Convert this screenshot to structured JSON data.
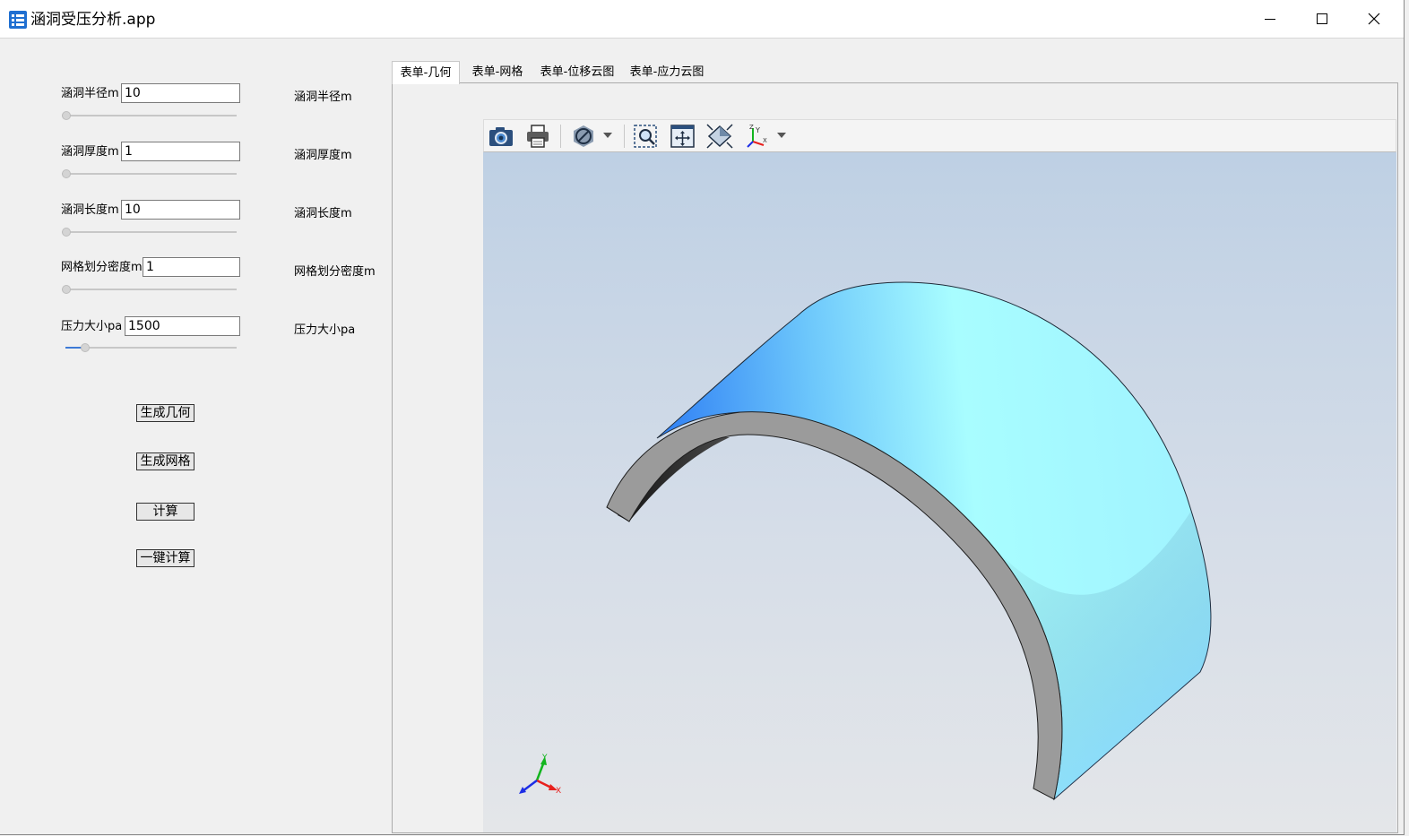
{
  "window": {
    "title": "涵洞受压分析.app",
    "controls": [
      "minimize-icon",
      "maximize-icon",
      "close-icon"
    ]
  },
  "params": [
    {
      "label": "涵洞半径m",
      "value": "10",
      "readout": "涵洞半径m",
      "slider_fraction": 0.0
    },
    {
      "label": "涵洞厚度m",
      "value": "1",
      "readout": "涵洞厚度m",
      "slider_fraction": 0.0
    },
    {
      "label": "涵洞长度m",
      "value": "10",
      "readout": "涵洞长度m",
      "slider_fraction": 0.0
    },
    {
      "label": "网格划分密度m",
      "value": "1",
      "readout": "网格划分密度m",
      "slider_fraction": 0.0
    },
    {
      "label": "压力大小pa",
      "value": "1500",
      "readout": "压力大小pa",
      "slider_fraction": 0.12
    }
  ],
  "actions": {
    "generate_geometry": "生成几何",
    "generate_mesh": "生成网格",
    "compute": "计算",
    "one_click_compute": "一键计算"
  },
  "tabs": [
    "表单-几何",
    "表单-网格",
    "表单-位移云图",
    "表单-应力云图"
  ],
  "active_tab": 0,
  "toolbar": [
    "camera-icon",
    "print-icon",
    "clip-plane-icon",
    "zoom-box-icon",
    "pan-icon",
    "fit-view-icon",
    "axes-orientation-icon"
  ],
  "axis_triad": {
    "x": "X",
    "y": "Y"
  },
  "colors": {
    "surface_light": "#a6fcff",
    "surface_dark": "#3b8cff",
    "section_gray": "#9b9b9b",
    "axis_x": "#e8201d",
    "axis_y": "#13b51f",
    "axis_z": "#1d2ee6"
  }
}
